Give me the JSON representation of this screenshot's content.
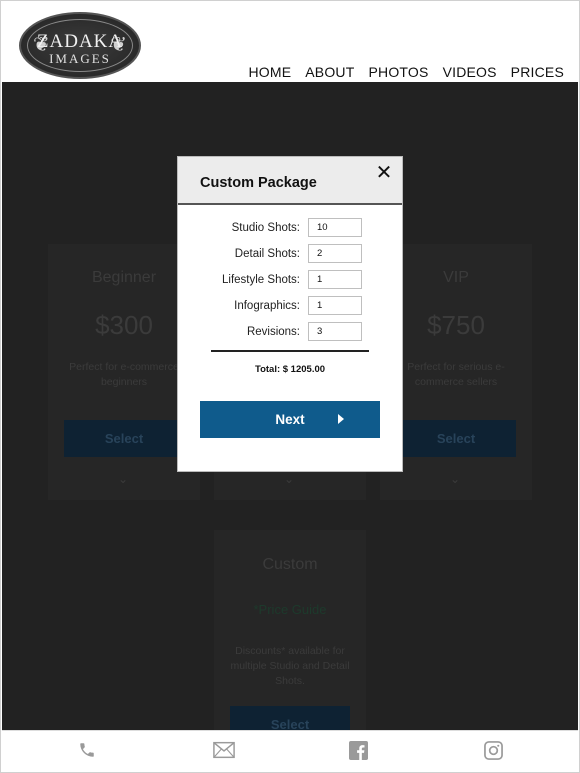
{
  "brand": {
    "line1": "ZADAKA",
    "line2": "IMAGES"
  },
  "nav": [
    {
      "label": "HOME"
    },
    {
      "label": "ABOUT"
    },
    {
      "label": "PHOTOS"
    },
    {
      "label": "VIDEOS"
    },
    {
      "label": "PRICES"
    }
  ],
  "cards": {
    "beginner": {
      "title": "Beginner",
      "price": "$300",
      "desc": "Perfect for e-commerce beginners",
      "button": "Select"
    },
    "vip": {
      "title": "VIP",
      "price": "$750",
      "desc": "Perfect for serious e-commerce sellers",
      "button": "Select"
    },
    "custom": {
      "title": "Custom",
      "price": "*Price Guide",
      "desc": "Discounts* available for multiple Studio and Detail Shots.",
      "button": "Select"
    }
  },
  "modal": {
    "title": "Custom Package",
    "close": "✕",
    "fields": [
      {
        "label": "Studio Shots:",
        "value": "10"
      },
      {
        "label": "Detail Shots:",
        "value": "2"
      },
      {
        "label": "Lifestyle Shots:",
        "value": "1"
      },
      {
        "label": "Infographics:",
        "value": "1"
      },
      {
        "label": "Revisions:",
        "value": "3"
      }
    ],
    "total": "Total: $ 1205.00",
    "next": "Next"
  },
  "footer": {
    "icons": [
      "phone-icon",
      "mail-icon",
      "facebook-icon",
      "instagram-icon"
    ]
  },
  "colors": {
    "accent": "#0f5b8c",
    "backdrop": "#222222"
  }
}
